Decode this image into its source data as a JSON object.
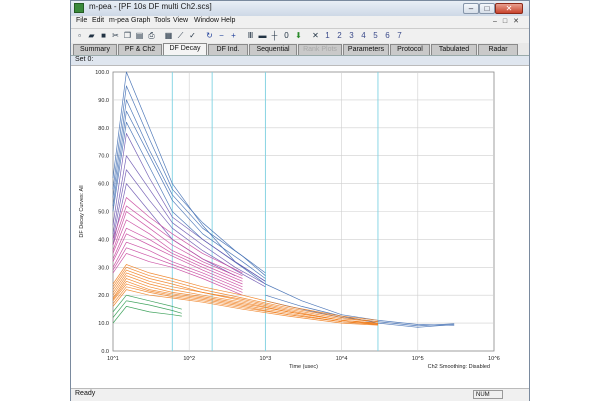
{
  "window": {
    "title": "m-pea - [PF 10s DF multi Ch2.scs]"
  },
  "menu": [
    "File",
    "Edit",
    "m-pea",
    "Graph",
    "Tools",
    "View",
    "Window",
    "Help"
  ],
  "tabs": [
    {
      "label": "Summary",
      "state": "normal"
    },
    {
      "label": "PF & Ch2",
      "state": "normal"
    },
    {
      "label": "DF Decay",
      "state": "active"
    },
    {
      "label": "DF Ind.",
      "state": "normal"
    },
    {
      "label": "Sequential",
      "state": "normal"
    },
    {
      "label": "Rank Plots",
      "state": "disabled"
    },
    {
      "label": "Parameters",
      "state": "normal"
    },
    {
      "label": "Protocol",
      "state": "normal"
    },
    {
      "label": "Tabulated",
      "state": "normal"
    },
    {
      "label": "Radar",
      "state": "normal"
    }
  ],
  "toolbar_icons": [
    "new-icon",
    "open-icon",
    "save-icon",
    "cut-icon",
    "copy-icon",
    "paste-icon",
    "print-icon",
    "chart-icon",
    "line-icon",
    "check-icon",
    "refresh-icon",
    "minus-icon",
    "plus-icon",
    "bars-icon",
    "marker-icon",
    "ruler-icon",
    "zero-icon",
    "down-arrow-icon",
    "set-icon",
    "set1-icon",
    "set2-icon",
    "set3-icon",
    "set4-icon",
    "set5-icon",
    "set6-icon",
    "set7-icon"
  ],
  "toolbar_set_labels": [
    "",
    "1",
    "2",
    "3",
    "4",
    "5",
    "6",
    "7"
  ],
  "set_label": "Set 0:",
  "status": {
    "text": "Ready",
    "num": "NUM"
  },
  "chart_data": {
    "type": "line",
    "ylabel": "DF Decay Curves: All",
    "xlabel": "Time (usec)",
    "note": "Ch2 Smoothing: Disabled",
    "x_scale": "log",
    "xlim": [
      10,
      1000000
    ],
    "ylim": [
      0,
      100
    ],
    "x_tick_labels": [
      "10^1",
      "10^2",
      "10^3",
      "10^4",
      "10^5",
      "10^6"
    ],
    "y_tick_labels": [
      "0.0",
      "10.0",
      "20.0",
      "30.0",
      "40.0",
      "50.0",
      "60.0",
      "70.0",
      "80.0",
      "90.0",
      "100.0"
    ],
    "vertical_markers_x": [
      60,
      200,
      1000,
      30000
    ],
    "colors": {
      "blue": "#3f6db3",
      "purple": "#6b55b0",
      "magenta": "#c8469f",
      "orange": "#f08020",
      "green": "#2e9a4e",
      "grid": "#cfcfcf",
      "marker": "#7fd3e3"
    },
    "series": [
      {
        "color": "blue",
        "points": [
          [
            10,
            62
          ],
          [
            15,
            100
          ],
          [
            30,
            80
          ],
          [
            60,
            60
          ],
          [
            150,
            45
          ],
          [
            400,
            32
          ],
          [
            1000,
            25
          ]
        ]
      },
      {
        "color": "blue",
        "points": [
          [
            10,
            58
          ],
          [
            15,
            95
          ],
          [
            30,
            76
          ],
          [
            60,
            58
          ],
          [
            150,
            46
          ],
          [
            400,
            36
          ],
          [
            1000,
            28
          ]
        ]
      },
      {
        "color": "blue",
        "points": [
          [
            10,
            55
          ],
          [
            15,
            90
          ],
          [
            30,
            72
          ],
          [
            60,
            56
          ],
          [
            150,
            44
          ],
          [
            500,
            34
          ],
          [
            1000,
            27
          ]
        ]
      },
      {
        "color": "blue",
        "points": [
          [
            10,
            52
          ],
          [
            15,
            86
          ],
          [
            30,
            70
          ],
          [
            60,
            54
          ],
          [
            150,
            42
          ],
          [
            500,
            32
          ],
          [
            1000,
            26
          ]
        ]
      },
      {
        "color": "blue",
        "points": [
          [
            10,
            50
          ],
          [
            15,
            82
          ],
          [
            30,
            66
          ],
          [
            60,
            50
          ],
          [
            150,
            40
          ],
          [
            500,
            30
          ],
          [
            1000,
            24
          ]
        ]
      },
      {
        "color": "blue",
        "points": [
          [
            1000,
            24
          ],
          [
            3000,
            18
          ],
          [
            10000,
            13
          ],
          [
            30000,
            11
          ],
          [
            100000,
            9.5
          ],
          [
            300000,
            9.2
          ]
        ]
      },
      {
        "color": "blue",
        "points": [
          [
            1000,
            20
          ],
          [
            3000,
            16
          ],
          [
            10000,
            12.5
          ],
          [
            30000,
            10
          ],
          [
            100000,
            8.5
          ],
          [
            300000,
            9.5
          ]
        ]
      },
      {
        "color": "blue",
        "points": [
          [
            1000,
            18
          ],
          [
            3000,
            15
          ],
          [
            10000,
            12
          ],
          [
            30000,
            10.5
          ],
          [
            100000,
            9
          ],
          [
            300000,
            9.8
          ]
        ]
      },
      {
        "color": "purple",
        "points": [
          [
            10,
            45
          ],
          [
            15,
            78
          ],
          [
            30,
            62
          ],
          [
            60,
            48
          ],
          [
            150,
            40
          ],
          [
            400,
            32
          ],
          [
            1000,
            25
          ]
        ]
      },
      {
        "color": "purple",
        "points": [
          [
            10,
            42
          ],
          [
            15,
            70
          ],
          [
            30,
            58
          ],
          [
            60,
            46
          ],
          [
            150,
            38
          ],
          [
            400,
            30
          ],
          [
            1000,
            24
          ]
        ]
      },
      {
        "color": "purple",
        "points": [
          [
            10,
            40
          ],
          [
            15,
            65
          ],
          [
            30,
            54
          ],
          [
            60,
            44
          ],
          [
            150,
            36
          ],
          [
            400,
            29
          ],
          [
            1000,
            23
          ]
        ]
      },
      {
        "color": "purple",
        "points": [
          [
            10,
            38
          ],
          [
            15,
            60
          ],
          [
            30,
            50
          ],
          [
            60,
            40
          ],
          [
            150,
            33
          ],
          [
            400,
            27
          ]
        ]
      },
      {
        "color": "magenta",
        "points": [
          [
            10,
            40
          ],
          [
            15,
            55
          ],
          [
            30,
            48
          ],
          [
            60,
            42
          ],
          [
            150,
            35
          ],
          [
            500,
            28
          ]
        ]
      },
      {
        "color": "magenta",
        "points": [
          [
            10,
            38
          ],
          [
            15,
            52
          ],
          [
            30,
            46
          ],
          [
            60,
            40
          ],
          [
            150,
            33
          ],
          [
            500,
            27
          ]
        ]
      },
      {
        "color": "magenta",
        "points": [
          [
            10,
            36
          ],
          [
            15,
            50
          ],
          [
            30,
            44
          ],
          [
            60,
            38
          ],
          [
            150,
            32
          ],
          [
            500,
            26
          ]
        ]
      },
      {
        "color": "magenta",
        "points": [
          [
            10,
            35
          ],
          [
            15,
            47
          ],
          [
            30,
            42
          ],
          [
            60,
            36
          ],
          [
            150,
            31
          ],
          [
            500,
            25
          ]
        ]
      },
      {
        "color": "magenta",
        "points": [
          [
            10,
            33
          ],
          [
            15,
            44
          ],
          [
            30,
            40
          ],
          [
            60,
            35
          ],
          [
            150,
            30
          ],
          [
            500,
            24
          ]
        ]
      },
      {
        "color": "magenta",
        "points": [
          [
            10,
            32
          ],
          [
            15,
            42
          ],
          [
            30,
            38
          ],
          [
            60,
            34
          ],
          [
            150,
            29
          ],
          [
            500,
            23
          ]
        ]
      },
      {
        "color": "magenta",
        "points": [
          [
            10,
            30
          ],
          [
            15,
            39
          ],
          [
            30,
            36
          ],
          [
            60,
            32
          ],
          [
            150,
            28
          ],
          [
            500,
            22
          ]
        ]
      },
      {
        "color": "magenta",
        "points": [
          [
            10,
            29
          ],
          [
            15,
            37
          ],
          [
            30,
            34
          ],
          [
            60,
            31
          ],
          [
            150,
            27
          ],
          [
            500,
            21
          ]
        ]
      },
      {
        "color": "magenta",
        "points": [
          [
            10,
            28
          ],
          [
            15,
            35
          ],
          [
            30,
            32
          ],
          [
            60,
            30
          ],
          [
            150,
            26
          ],
          [
            500,
            20
          ]
        ]
      },
      {
        "color": "orange",
        "points": [
          [
            10,
            24
          ],
          [
            15,
            31
          ],
          [
            30,
            28
          ],
          [
            60,
            26
          ],
          [
            150,
            23
          ],
          [
            500,
            20
          ],
          [
            2000,
            16
          ],
          [
            10000,
            12.5
          ],
          [
            30000,
            11
          ]
        ]
      },
      {
        "color": "orange",
        "points": [
          [
            10,
            23
          ],
          [
            15,
            30
          ],
          [
            30,
            27
          ],
          [
            60,
            25
          ],
          [
            150,
            22
          ],
          [
            500,
            19
          ],
          [
            2000,
            15.5
          ],
          [
            10000,
            12
          ],
          [
            30000,
            10.5
          ]
        ]
      },
      {
        "color": "orange",
        "points": [
          [
            10,
            22
          ],
          [
            15,
            29
          ],
          [
            30,
            26
          ],
          [
            60,
            24
          ],
          [
            150,
            21
          ],
          [
            500,
            18.5
          ],
          [
            2000,
            15
          ],
          [
            10000,
            11.5
          ],
          [
            30000,
            10.5
          ]
        ]
      },
      {
        "color": "orange",
        "points": [
          [
            10,
            21
          ],
          [
            15,
            28
          ],
          [
            30,
            25
          ],
          [
            60,
            23
          ],
          [
            150,
            21
          ],
          [
            500,
            18
          ],
          [
            2000,
            14.5
          ],
          [
            10000,
            11
          ],
          [
            30000,
            10
          ]
        ]
      },
      {
        "color": "orange",
        "points": [
          [
            10,
            20
          ],
          [
            15,
            27
          ],
          [
            30,
            24
          ],
          [
            60,
            22
          ],
          [
            150,
            20
          ],
          [
            500,
            17.5
          ],
          [
            2000,
            14
          ],
          [
            10000,
            11
          ],
          [
            30000,
            10
          ]
        ]
      },
      {
        "color": "orange",
        "points": [
          [
            10,
            19
          ],
          [
            15,
            26
          ],
          [
            30,
            23
          ],
          [
            60,
            21
          ],
          [
            150,
            19.5
          ],
          [
            500,
            17
          ],
          [
            2000,
            14
          ],
          [
            10000,
            11
          ],
          [
            30000,
            9.8
          ]
        ]
      },
      {
        "color": "orange",
        "points": [
          [
            10,
            18.5
          ],
          [
            15,
            25
          ],
          [
            30,
            22
          ],
          [
            60,
            20.5
          ],
          [
            150,
            19
          ],
          [
            500,
            16.5
          ],
          [
            2000,
            13.5
          ],
          [
            10000,
            10.5
          ],
          [
            30000,
            9.8
          ]
        ]
      },
      {
        "color": "orange",
        "points": [
          [
            10,
            18
          ],
          [
            15,
            24
          ],
          [
            30,
            21.5
          ],
          [
            60,
            20
          ],
          [
            150,
            18.5
          ],
          [
            500,
            16
          ],
          [
            2000,
            13
          ],
          [
            10000,
            10.5
          ],
          [
            30000,
            9.5
          ]
        ]
      },
      {
        "color": "orange",
        "points": [
          [
            10,
            17
          ],
          [
            15,
            23
          ],
          [
            30,
            21
          ],
          [
            60,
            19.5
          ],
          [
            150,
            18
          ],
          [
            500,
            15.5
          ],
          [
            2000,
            13
          ],
          [
            10000,
            10.5
          ],
          [
            30000,
            9.5
          ]
        ]
      },
      {
        "color": "orange",
        "points": [
          [
            10,
            16
          ],
          [
            15,
            22
          ],
          [
            30,
            20
          ],
          [
            60,
            19
          ],
          [
            150,
            17.5
          ],
          [
            500,
            15
          ],
          [
            2000,
            12.5
          ],
          [
            10000,
            10
          ],
          [
            30000,
            9.3
          ]
        ]
      },
      {
        "color": "green",
        "points": [
          [
            10,
            14
          ],
          [
            15,
            20
          ],
          [
            30,
            18
          ],
          [
            60,
            16
          ],
          [
            80,
            15
          ]
        ]
      },
      {
        "color": "green",
        "points": [
          [
            10,
            12
          ],
          [
            15,
            18
          ],
          [
            30,
            16.5
          ],
          [
            60,
            14.5
          ],
          [
            80,
            13.5
          ]
        ]
      },
      {
        "color": "green",
        "points": [
          [
            10,
            10
          ],
          [
            15,
            16
          ],
          [
            30,
            14
          ],
          [
            60,
            13
          ],
          [
            80,
            12.5
          ]
        ]
      }
    ]
  }
}
